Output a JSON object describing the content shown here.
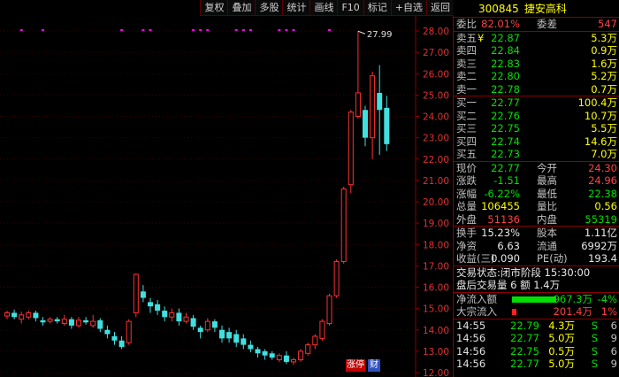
{
  "toolbar": [
    "复权",
    "叠加",
    "多股",
    "统计",
    "画线",
    "F10",
    "标记",
    "+自选",
    "返回"
  ],
  "chart_data": {
    "type": "candlestick",
    "y_ticks": [
      "28.00",
      "27.00",
      "26.00",
      "25.00",
      "24.00",
      "23.00",
      "22.00",
      "21.00",
      "20.00",
      "19.00",
      "18.00",
      "17.00",
      "16.00",
      "15.00",
      "14.00",
      "13.00",
      "12.00"
    ],
    "ylim": [
      12.0,
      28.0
    ],
    "max_label": "27.99",
    "candles": [
      {
        "o": 14.65,
        "c": 14.8,
        "h": 14.9,
        "l": 14.5
      },
      {
        "o": 14.8,
        "c": 14.6,
        "h": 14.95,
        "l": 14.5
      },
      {
        "o": 14.5,
        "c": 14.7,
        "h": 14.85,
        "l": 14.3
      },
      {
        "o": 14.6,
        "c": 14.8,
        "h": 14.9,
        "l": 14.5
      },
      {
        "o": 14.8,
        "c": 14.55,
        "h": 14.9,
        "l": 14.4
      },
      {
        "o": 14.45,
        "c": 14.35,
        "h": 14.6,
        "l": 14.2
      },
      {
        "o": 14.4,
        "c": 14.5,
        "h": 14.6,
        "l": 14.3
      },
      {
        "o": 14.5,
        "c": 14.4,
        "h": 14.6,
        "l": 14.3
      },
      {
        "o": 14.3,
        "c": 14.5,
        "h": 14.7,
        "l": 14.2
      },
      {
        "o": 14.5,
        "c": 14.2,
        "h": 14.6,
        "l": 14.05
      },
      {
        "o": 14.2,
        "c": 14.45,
        "h": 14.6,
        "l": 14.1
      },
      {
        "o": 14.45,
        "c": 14.35,
        "h": 14.6,
        "l": 14.25
      },
      {
        "o": 14.2,
        "c": 14.4,
        "h": 14.7,
        "l": 14.1
      },
      {
        "o": 14.45,
        "c": 14.05,
        "h": 14.55,
        "l": 13.9
      },
      {
        "o": 14.0,
        "c": 13.8,
        "h": 14.2,
        "l": 13.6
      },
      {
        "o": 13.7,
        "c": 13.5,
        "h": 13.9,
        "l": 13.3
      },
      {
        "o": 13.5,
        "c": 13.2,
        "h": 13.7,
        "l": 13.1
      },
      {
        "o": 13.4,
        "c": 14.4,
        "h": 14.5,
        "l": 13.3
      },
      {
        "o": 14.8,
        "c": 16.6,
        "h": 16.65,
        "l": 14.6
      },
      {
        "o": 15.8,
        "c": 15.5,
        "h": 16.1,
        "l": 15.3
      },
      {
        "o": 15.3,
        "c": 15.1,
        "h": 15.5,
        "l": 14.8
      },
      {
        "o": 15.2,
        "c": 14.9,
        "h": 15.4,
        "l": 14.7
      },
      {
        "o": 14.9,
        "c": 14.6,
        "h": 15.1,
        "l": 14.4
      },
      {
        "o": 14.6,
        "c": 14.8,
        "h": 15.0,
        "l": 14.4
      },
      {
        "o": 14.8,
        "c": 14.4,
        "h": 15.0,
        "l": 14.2
      },
      {
        "o": 14.4,
        "c": 14.6,
        "h": 14.8,
        "l": 14.3
      },
      {
        "o": 14.55,
        "c": 14.15,
        "h": 14.7,
        "l": 14.0
      },
      {
        "o": 14.1,
        "c": 13.9,
        "h": 14.2,
        "l": 13.6
      },
      {
        "o": 14.0,
        "c": 14.4,
        "h": 14.55,
        "l": 13.9
      },
      {
        "o": 14.4,
        "c": 14.1,
        "h": 14.5,
        "l": 13.9
      },
      {
        "o": 14.0,
        "c": 13.6,
        "h": 14.2,
        "l": 13.4
      },
      {
        "o": 13.9,
        "c": 13.6,
        "h": 14.1,
        "l": 13.4
      },
      {
        "o": 13.8,
        "c": 13.4,
        "h": 14.0,
        "l": 13.2
      },
      {
        "o": 13.6,
        "c": 13.3,
        "h": 13.8,
        "l": 13.1
      },
      {
        "o": 13.3,
        "c": 13.1,
        "h": 13.5,
        "l": 12.95
      },
      {
        "o": 13.1,
        "c": 12.9,
        "h": 13.2,
        "l": 12.7
      },
      {
        "o": 13.0,
        "c": 12.8,
        "h": 13.1,
        "l": 12.6
      },
      {
        "o": 12.9,
        "c": 12.7,
        "h": 13.0,
        "l": 12.6
      },
      {
        "o": 12.6,
        "c": 12.8,
        "h": 12.9,
        "l": 12.5
      },
      {
        "o": 12.8,
        "c": 12.5,
        "h": 13.0,
        "l": 12.4
      },
      {
        "o": 12.5,
        "c": 12.6,
        "h": 12.7,
        "l": 12.35
      },
      {
        "o": 12.6,
        "c": 13.0,
        "h": 13.1,
        "l": 12.5
      },
      {
        "o": 12.9,
        "c": 13.3,
        "h": 13.4,
        "l": 12.8
      },
      {
        "o": 13.3,
        "c": 13.7,
        "h": 13.8,
        "l": 13.1
      },
      {
        "o": 13.6,
        "c": 14.4,
        "h": 14.5,
        "l": 13.5
      },
      {
        "o": 14.3,
        "c": 15.6,
        "h": 15.7,
        "l": 14.2
      },
      {
        "o": 15.6,
        "c": 17.2,
        "h": 17.3,
        "l": 15.5
      },
      {
        "o": 17.2,
        "c": 20.6,
        "h": 20.7,
        "l": 17.1
      },
      {
        "o": 20.8,
        "c": 24.2,
        "h": 24.3,
        "l": 20.4
      },
      {
        "o": 24.0,
        "c": 25.1,
        "h": 27.99,
        "l": 23.9
      },
      {
        "o": 24.3,
        "c": 23.0,
        "h": 24.5,
        "l": 22.6
      },
      {
        "o": 23.0,
        "c": 25.9,
        "h": 26.1,
        "l": 22.0
      },
      {
        "o": 25.1,
        "c": 24.3,
        "h": 26.4,
        "l": 22.2
      },
      {
        "o": 24.4,
        "c": 22.7,
        "h": 24.96,
        "l": 22.38
      }
    ],
    "markers_x": [
      2,
      5,
      16,
      19,
      20,
      26,
      27,
      28,
      32,
      33,
      34,
      38,
      39,
      40,
      45
    ]
  },
  "stock": {
    "code": "300845",
    "name": "捷安高科"
  },
  "weibi": {
    "label": "委比",
    "value": "82.01%",
    "label2": "委差",
    "value2": "547"
  },
  "asks": [
    {
      "label": "卖五",
      "mark": "¥",
      "price": "22.87",
      "vol": "5.3万"
    },
    {
      "label": "卖四",
      "mark": "",
      "price": "22.84",
      "vol": "0.9万"
    },
    {
      "label": "卖三",
      "mark": "",
      "price": "22.83",
      "vol": "1.6万"
    },
    {
      "label": "卖二",
      "mark": "",
      "price": "22.80",
      "vol": "5.2万"
    },
    {
      "label": "卖一",
      "mark": "",
      "price": "22.78",
      "vol": "0.7万"
    }
  ],
  "bids": [
    {
      "label": "买一",
      "price": "22.77",
      "vol": "100.4万"
    },
    {
      "label": "买二",
      "price": "22.76",
      "vol": "10.7万"
    },
    {
      "label": "买三",
      "price": "22.75",
      "vol": "5.5万"
    },
    {
      "label": "买四",
      "price": "22.74",
      "vol": "14.6万"
    },
    {
      "label": "买五",
      "price": "22.73",
      "vol": "7.0万"
    }
  ],
  "quote": [
    {
      "l1": "现价",
      "v1": "22.77",
      "c1": "green",
      "l2": "今开",
      "v2": "24.30",
      "c2": "red"
    },
    {
      "l1": "涨跌",
      "v1": "-1.51",
      "c1": "green",
      "l2": "最高",
      "v2": "24.96",
      "c2": "red"
    },
    {
      "l1": "涨幅",
      "v1": "-6.22%",
      "c1": "green",
      "l2": "最低",
      "v2": "22.38",
      "c2": "green"
    },
    {
      "l1": "总量",
      "v1": "106455",
      "c1": "yellow",
      "l2": "量比",
      "v2": "0.56",
      "c2": "yellow"
    },
    {
      "l1": "外盘",
      "v1": "51136",
      "c1": "red",
      "l2": "内盘",
      "v2": "55319",
      "c2": "green"
    }
  ],
  "stats": [
    {
      "l1": "换手",
      "v1": "15.23%",
      "l2": "股本",
      "v2": "1.11亿"
    },
    {
      "l1": "净资",
      "v1": "6.63",
      "l2": "流通",
      "v2": "6992万"
    },
    {
      "l1": "收益(三)",
      "v1": "0.090",
      "l2": "PE(动)",
      "v2": "193.4"
    }
  ],
  "status": {
    "line1": "交易状态:闭市阶段 15:30:00",
    "line2": "盘后交易量 6 额 1.4万"
  },
  "flows": [
    {
      "label": "净流入额",
      "value": "-967.3万",
      "pct": "-4%",
      "color": "green"
    },
    {
      "label": "大宗流入",
      "value": "201.4万",
      "pct": "1%",
      "color": "red"
    }
  ],
  "ticks": [
    {
      "time": "14:55",
      "price": "22.79",
      "vol": "4.3万",
      "side": "S",
      "count": "6"
    },
    {
      "time": "14:56",
      "price": "22.77",
      "vol": "5.0万",
      "side": "S",
      "count": "9"
    },
    {
      "time": "14:56",
      "price": "22.75",
      "vol": "0.5万",
      "side": "S",
      "count": "6"
    },
    {
      "time": "14:56",
      "price": "22.77",
      "vol": "5.0万",
      "side": "S",
      "count": "9"
    }
  ],
  "tags": {
    "zhangting": "涨停",
    "cai": "财"
  },
  "colors": {
    "up": "#ff3030",
    "down": "#40e0e0",
    "marker": "#ff00ff",
    "border": "#8b0000"
  }
}
